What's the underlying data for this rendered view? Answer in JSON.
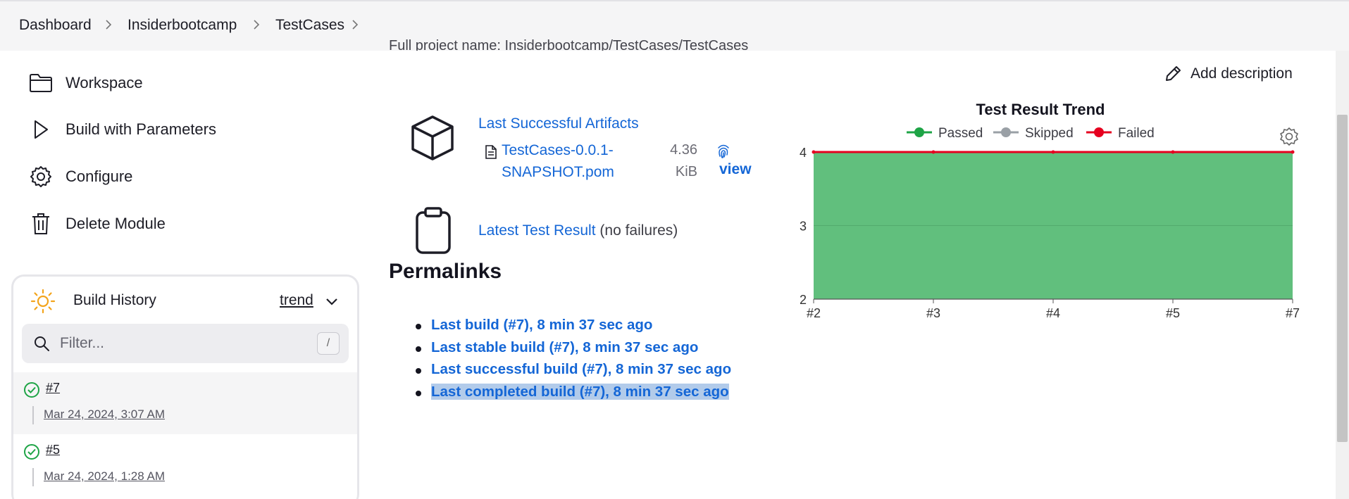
{
  "breadcrumb": [
    "Dashboard",
    "Insiderbootcamp",
    "TestCases"
  ],
  "sidebar": {
    "items": [
      {
        "label": "Workspace",
        "icon": "folder-icon"
      },
      {
        "label": "Build with Parameters",
        "icon": "play-icon"
      },
      {
        "label": "Configure",
        "icon": "gear-icon"
      },
      {
        "label": "Delete Module",
        "icon": "trash-icon"
      }
    ]
  },
  "build_history": {
    "title": "Build History",
    "trend_label": "trend",
    "filter_placeholder": "Filter...",
    "filter_shortcut": "/",
    "builds": [
      {
        "number": "#7",
        "date": "Mar 24, 2024, 3:07 AM",
        "status": "success"
      },
      {
        "number": "#5",
        "date": "Mar 24, 2024, 1:28 AM",
        "status": "success"
      }
    ]
  },
  "main": {
    "project_name_line": "Full project name: Insiderbootcamp/TestCases/TestCases",
    "add_description": "Add description",
    "artifacts": {
      "title": "Last Successful Artifacts",
      "file": "TestCases-0.0.1-SNAPSHOT.pom",
      "size": "4.36 KiB",
      "view": "view"
    },
    "latest_test": {
      "link": "Latest Test Result",
      "suffix": "(no failures)"
    },
    "permalinks_title": "Permalinks",
    "permalinks": [
      "Last build (#7), 8 min 37 sec ago",
      "Last stable build (#7), 8 min 37 sec ago",
      "Last successful build (#7), 8 min 37 sec ago",
      "Last completed build (#7), 8 min 37 sec ago"
    ]
  },
  "chart_data": {
    "type": "area",
    "title": "Test Result Trend",
    "categories": [
      "#2",
      "#3",
      "#4",
      "#5",
      "#7"
    ],
    "series": [
      {
        "name": "Passed",
        "values": [
          4,
          4,
          4,
          4,
          4
        ],
        "color": "#1ea446"
      },
      {
        "name": "Skipped",
        "values": [
          0,
          0,
          0,
          0,
          0
        ],
        "color": "#9aa0a6"
      },
      {
        "name": "Failed",
        "values": [
          0,
          0,
          0,
          0,
          0
        ],
        "color": "#e6001f"
      }
    ],
    "ylim": [
      2,
      4
    ],
    "yticks": [
      2,
      3,
      4
    ],
    "legend_position": "top",
    "grid": true
  }
}
